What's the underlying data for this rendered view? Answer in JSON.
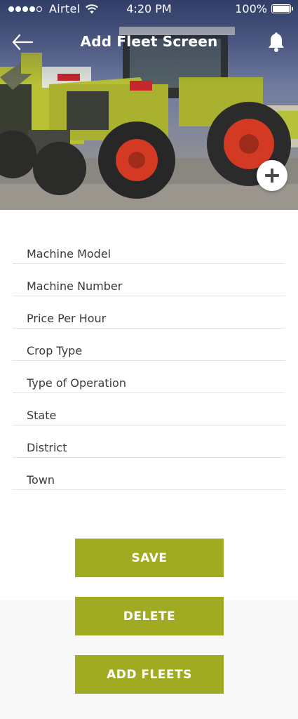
{
  "status_bar": {
    "carrier": "Airtel",
    "time": "4:20 PM",
    "battery": "100%",
    "battery_level": 1.0,
    "signal_bars_filled": 4,
    "signal_bars_total": 5
  },
  "header": {
    "title": "Add Fleet Screen",
    "back_icon": "back-arrow-icon",
    "notification_icon": "bell-icon"
  },
  "hero": {
    "image_subject": "tractor-photo",
    "add_photo_icon": "plus-icon"
  },
  "form": {
    "fields": [
      {
        "placeholder": "Machine Model",
        "value": ""
      },
      {
        "placeholder": "Machine Number",
        "value": ""
      },
      {
        "placeholder": "Price Per Hour",
        "value": ""
      },
      {
        "placeholder": "Crop Type",
        "value": ""
      },
      {
        "placeholder": "Type of Operation",
        "value": ""
      },
      {
        "placeholder": "State",
        "value": ""
      },
      {
        "placeholder": "District",
        "value": ""
      },
      {
        "placeholder": "Town",
        "value": ""
      }
    ]
  },
  "actions": {
    "save_label": "SAVE",
    "delete_label": "DELETE",
    "add_fleets_label": "ADD FLEETS"
  },
  "colors": {
    "accent": "#a1ab21",
    "header_overlay": "#3a4a7a",
    "divider": "#e4e4e4",
    "lower_background": "#f8f8f8"
  }
}
